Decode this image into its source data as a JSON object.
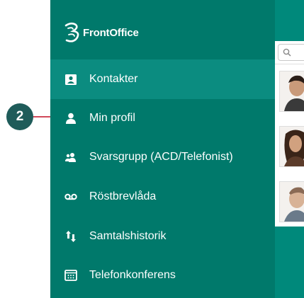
{
  "app": {
    "brand_name": "FrontOffice"
  },
  "sidebar": {
    "items": [
      {
        "label": "Kontakter",
        "icon": "contacts-icon",
        "active": true
      },
      {
        "label": "Min profil",
        "icon": "person-icon",
        "active": false
      },
      {
        "label": "Svarsgrupp (ACD/Telefonist)",
        "icon": "group-icon",
        "active": false
      },
      {
        "label": "Röstbrevlåda",
        "icon": "voicemail-icon",
        "active": false
      },
      {
        "label": "Samtalshistorik",
        "icon": "swap-vert-icon",
        "active": false
      },
      {
        "label": "Telefonkonferens",
        "icon": "dialpad-icon",
        "active": false
      }
    ]
  },
  "right_panel": {
    "search_icon": "search-icon",
    "avatars": 3
  },
  "callout": {
    "label": "2",
    "color": "#d04a5a"
  },
  "colors": {
    "sidebar_bg": "#00796b",
    "app_bg": "#00897b",
    "active_bg": "#0b8c80",
    "callout_bg": "#1f5c5a"
  }
}
